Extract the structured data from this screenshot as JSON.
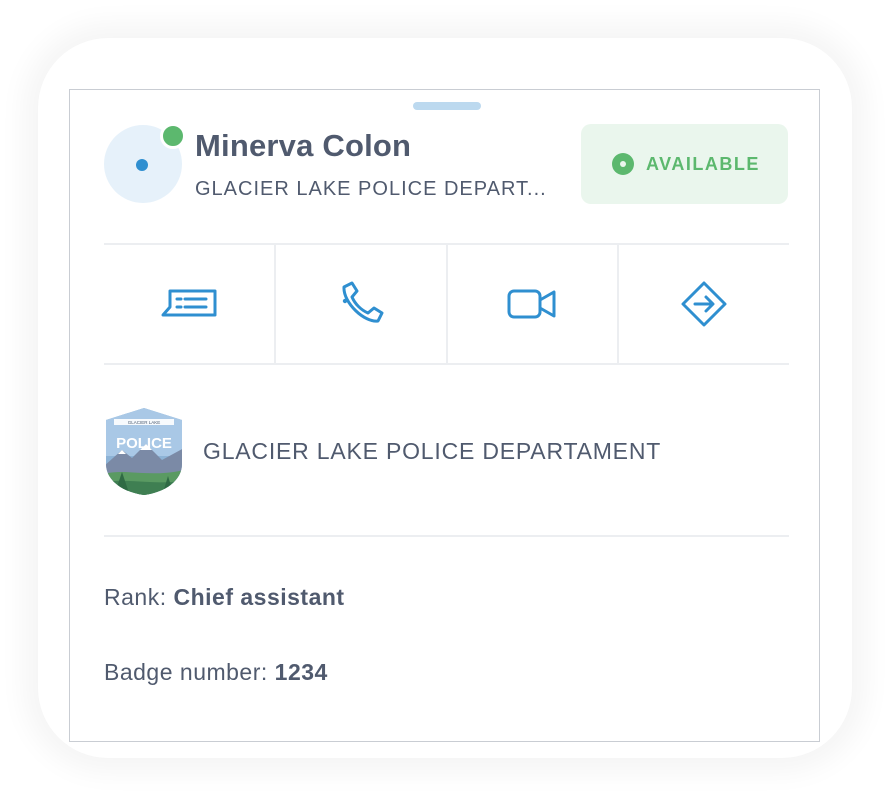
{
  "contact": {
    "name": "Minerva Colon",
    "organization_short": "GLACIER LAKE POLICE DEPART...",
    "presence": "online"
  },
  "status": {
    "label": "AVAILABLE",
    "color": "#5cb86e",
    "icon": "status-dot-icon"
  },
  "actions": [
    {
      "name": "message",
      "icon": "message-icon"
    },
    {
      "name": "call",
      "icon": "phone-icon"
    },
    {
      "name": "video",
      "icon": "video-camera-icon"
    },
    {
      "name": "directions",
      "icon": "directions-icon"
    }
  ],
  "department": {
    "name": "GLACIER LAKE POLICE DEPARTAMENT",
    "logo": {
      "banner_text": "GLACIER LAKE",
      "shield_text": "POLICE"
    }
  },
  "details": {
    "rank_label": "Rank:",
    "rank_value": "Chief assistant",
    "badge_label": "Badge number:",
    "badge_value": "1234"
  },
  "colors": {
    "accent": "#2f8fd0",
    "text": "#505a6e",
    "available": "#5cb86e"
  }
}
